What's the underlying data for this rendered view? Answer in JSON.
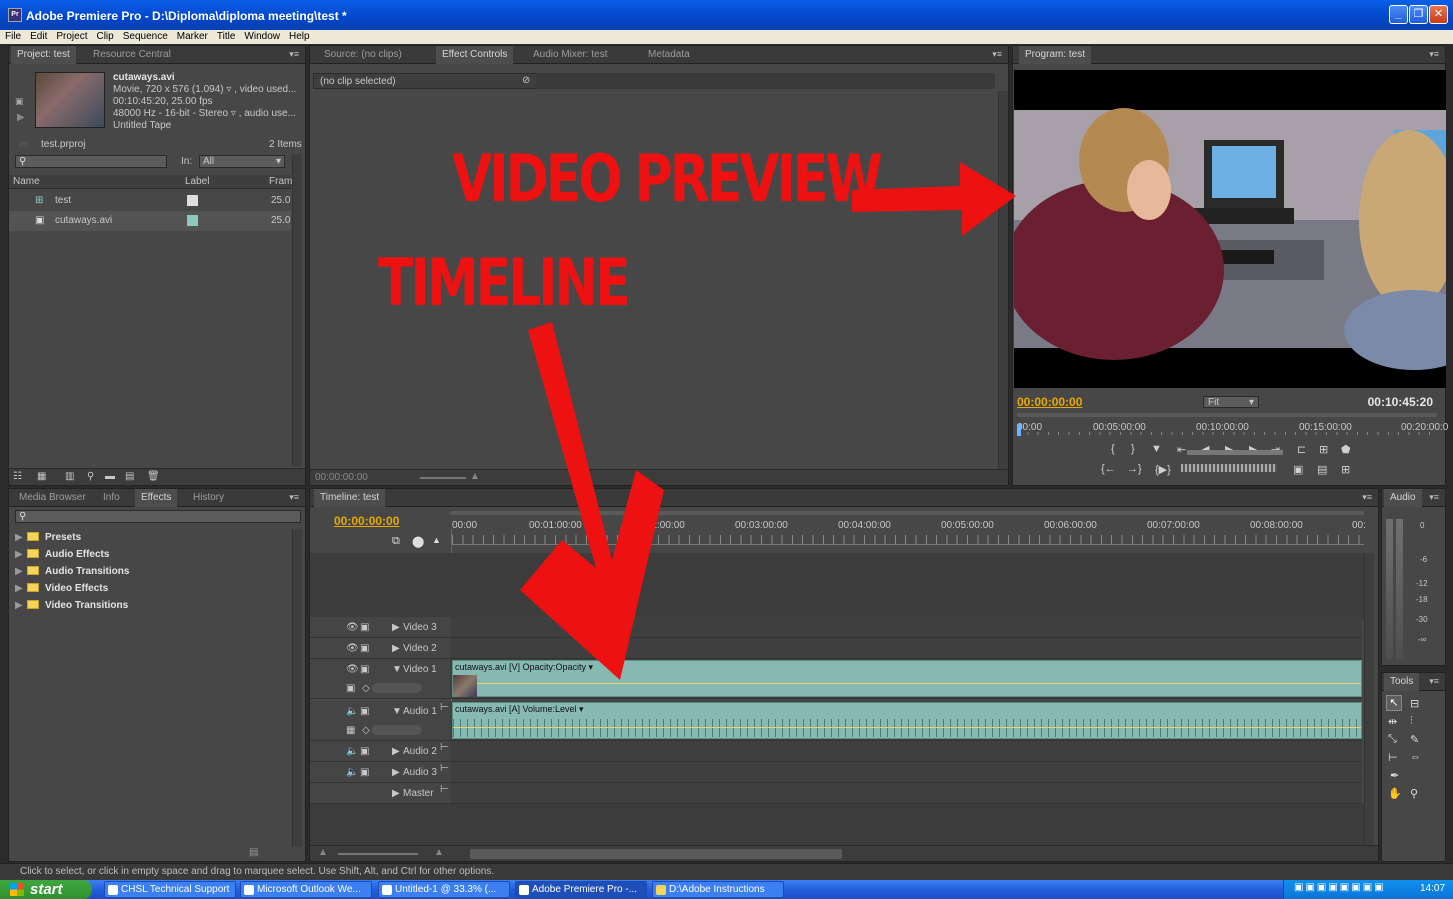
{
  "window": {
    "title": "Adobe Premiere Pro - D:\\Diploma\\diploma meeting\\test *",
    "app_icon": "Pr"
  },
  "menu": [
    "File",
    "Edit",
    "Project",
    "Clip",
    "Sequence",
    "Marker",
    "Title",
    "Window",
    "Help"
  ],
  "project_panel": {
    "tabs": [
      "Project: test",
      "Resource Central"
    ],
    "clip_name": "cutaways.avi",
    "clip_info": [
      "Movie, 720 x 576 (1.094) ▿ , video used...",
      "00:10:45:20, 25.00 fps",
      "48000 Hz - 16-bit - Stereo ▿ , audio use...",
      "Untitled Tape"
    ],
    "project_file": "test.prproj",
    "items_count": "2 Items",
    "in_label": "In:",
    "in_value": "All",
    "columns": [
      "Name",
      "Label",
      "Fram"
    ],
    "rows": [
      {
        "name": "test",
        "rate": "25.0"
      },
      {
        "name": "cutaways.avi",
        "rate": "25.0"
      }
    ]
  },
  "source_panel": {
    "tabs": [
      "Source: (no clips)",
      "Effect Controls",
      "Audio Mixer: test",
      "Metadata"
    ],
    "no_clip": "(no clip selected)",
    "timecode": "00:00:00:00"
  },
  "program_panel": {
    "tab": "Program: test",
    "timecode_in": "00:00:00:00",
    "fit_label": "Fit",
    "duration": "00:10:45:20",
    "ruler": [
      "00:00",
      "00:05:00:00",
      "00:10:00:00",
      "00:15:00:00",
      "00:20:00:0"
    ],
    "playhead_fraction": 0.0
  },
  "effects_panel": {
    "tabs": [
      "Media Browser",
      "Info",
      "Effects",
      "History"
    ],
    "items": [
      "Presets",
      "Audio Effects",
      "Audio Transitions",
      "Video Effects",
      "Video Transitions"
    ]
  },
  "timeline_panel": {
    "tab": "Timeline: test",
    "timecode": "00:00:00:00",
    "ruler": [
      "00:00",
      "00:01:00:00",
      "00:02:00:00",
      "00:03:00:00",
      "00:04:00:00",
      "00:05:00:00",
      "00:06:00:00",
      "00:07:00:00",
      "00:08:00:00",
      "00:"
    ],
    "tracks": [
      "Video 3",
      "Video 2",
      "Video 1",
      "Audio 1",
      "Audio 2",
      "Audio 3",
      "Master"
    ],
    "video_clip": "cutaways.avi [V]  Opacity:Opacity ▾",
    "audio_clip": "cutaways.avi [A]  Volume:Level ▾"
  },
  "audio_meter": {
    "tab": "Audio",
    "scale": [
      "0",
      "-6",
      "-12",
      "-18",
      "-30",
      "-∞"
    ]
  },
  "tools_panel": {
    "tab": "Tools"
  },
  "annotations": {
    "video_preview": "VIDEO PREVIEW",
    "timeline": "TIMELINE",
    "color": "#ee1111"
  },
  "status_bar": "Click to select, or click in empty space and drag to marquee select. Use Shift, Alt, and Ctrl for other options.",
  "taskbar": {
    "start": "start",
    "tasks": [
      "CHSL Technical Support",
      "Microsoft Outlook We...",
      "Untitled-1 @ 33.3% (...",
      "Adobe Premiere Pro -...",
      "D:\\Adobe Instructions"
    ],
    "clock": "14:07"
  },
  "colors": {
    "accent_timecode": "#e8a800",
    "panel_bg": "#474747",
    "clip_color": "#86b9b1",
    "xp_blue": "#245edb"
  }
}
